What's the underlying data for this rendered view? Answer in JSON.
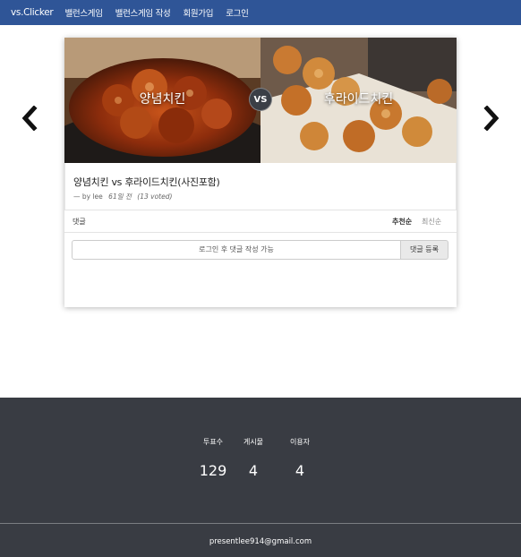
{
  "navbar": {
    "brand": "vs.Clicker",
    "links": [
      "밸런스게임",
      "밸런스게임 작성",
      "회원가입",
      "로그인"
    ]
  },
  "post": {
    "option_a": "양념치킨",
    "option_b": "후라이드치킨",
    "vs": "VS",
    "title": "양념치킨 vs 후라이드치킨(사진포함)",
    "author": "— by lee",
    "ago": "61일 전",
    "votes": "(13 voted)"
  },
  "comments": {
    "label": "댓글",
    "sort_recommended": "추천순",
    "sort_latest": "최신순",
    "input_placeholder": "로그인 후 댓글 작성 가능",
    "submit_label": "댓글 등록"
  },
  "footer": {
    "stats": [
      {
        "label": "투표수",
        "value": "129"
      },
      {
        "label": "게시물",
        "value": "4"
      },
      {
        "label": "이용자",
        "value": "4"
      }
    ],
    "email": "presentlee914@gmail.com"
  },
  "colors": {
    "navbar": "#2f5597",
    "footer": "#393c43"
  },
  "icons": {
    "prev": "chevron-left-icon",
    "next": "chevron-right-icon"
  }
}
